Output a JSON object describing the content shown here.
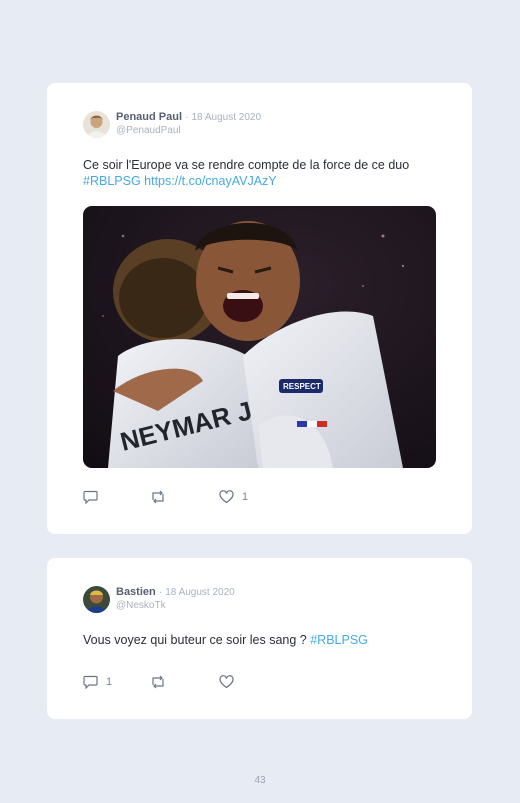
{
  "tweets": [
    {
      "author": "Penaud Paul",
      "separator": "·",
      "date": "18 August 2020",
      "handle": "@PenaudPaul",
      "text_before": "Ce soir l'Europe va se rendre compte de la force de ce duo",
      "hashtag": "#RBLPSG",
      "link": "https://t.co/cnayAVJAzY",
      "likes": "1"
    },
    {
      "author": "Bastien",
      "separator": "·",
      "date": "18 August 2020",
      "handle": "@NeskoTk",
      "text_before": "Vous voyez qui buteur ce soir les sang ? ",
      "hashtag": "#RBLPSG",
      "replies": "1"
    }
  ],
  "photo": {
    "jersey_text": "NEYMAR JR",
    "badge_text": "RESPECT"
  },
  "page_number": "43",
  "colors": {
    "background": "#e7ebf3",
    "card": "#ffffff",
    "link": "#47a8e5",
    "name": "#586070",
    "meta": "#aab2bd"
  },
  "icons": [
    "reply-icon",
    "retweet-icon",
    "like-icon"
  ]
}
